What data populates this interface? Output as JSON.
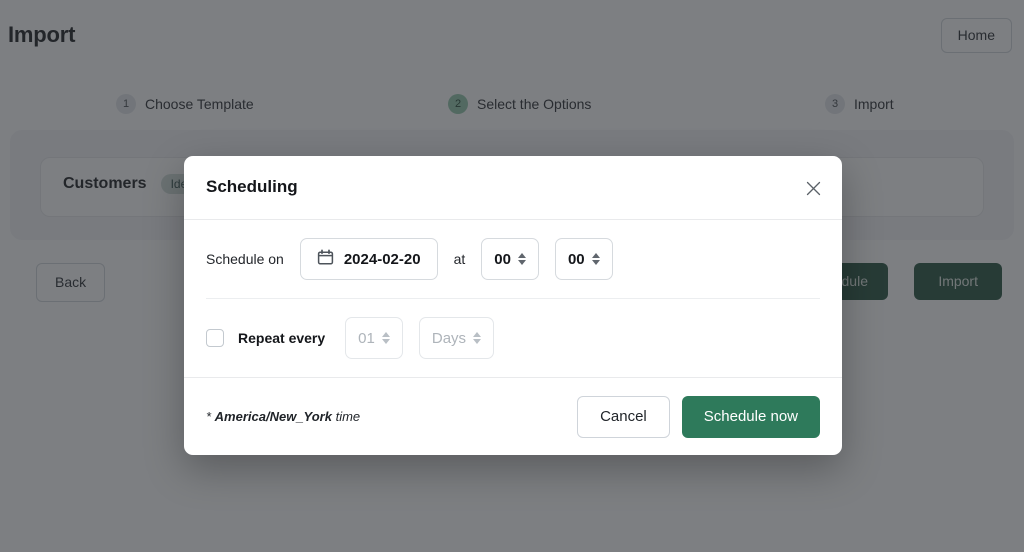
{
  "header": {
    "title": "Import",
    "home_label": "Home"
  },
  "stepper": {
    "steps": [
      {
        "number": "1",
        "label": "Choose Template",
        "active": false
      },
      {
        "number": "2",
        "label": "Select the Options",
        "active": true
      },
      {
        "number": "3",
        "label": "Import",
        "active": false
      }
    ]
  },
  "content": {
    "entity_name": "Customers",
    "entity_badge": "Identifier"
  },
  "actions": {
    "back_label": "Back",
    "schedule_label": "Schedule",
    "import_label": "Import"
  },
  "modal": {
    "title": "Scheduling",
    "close_icon": "close-icon",
    "schedule_on_label": "Schedule on",
    "date_value": "2024-02-20",
    "calendar_icon": "calendar-icon",
    "at_label": "at",
    "hour_value": "00",
    "minute_value": "00",
    "repeat_label": "Repeat every",
    "repeat_checked": false,
    "repeat_count_value": "01",
    "repeat_unit_value": "Days",
    "timezone_prefix": "* ",
    "timezone_name": "America/New_York",
    "timezone_suffix": " time",
    "cancel_label": "Cancel",
    "submit_label": "Schedule now"
  },
  "colors": {
    "accent_green": "#2e7a5b",
    "dark_green": "#1f4d37",
    "step_active_badge": "#8fc6a9",
    "badge_teal": "#cfdcd8",
    "overlay": "rgba(45,49,54,0.62)"
  }
}
